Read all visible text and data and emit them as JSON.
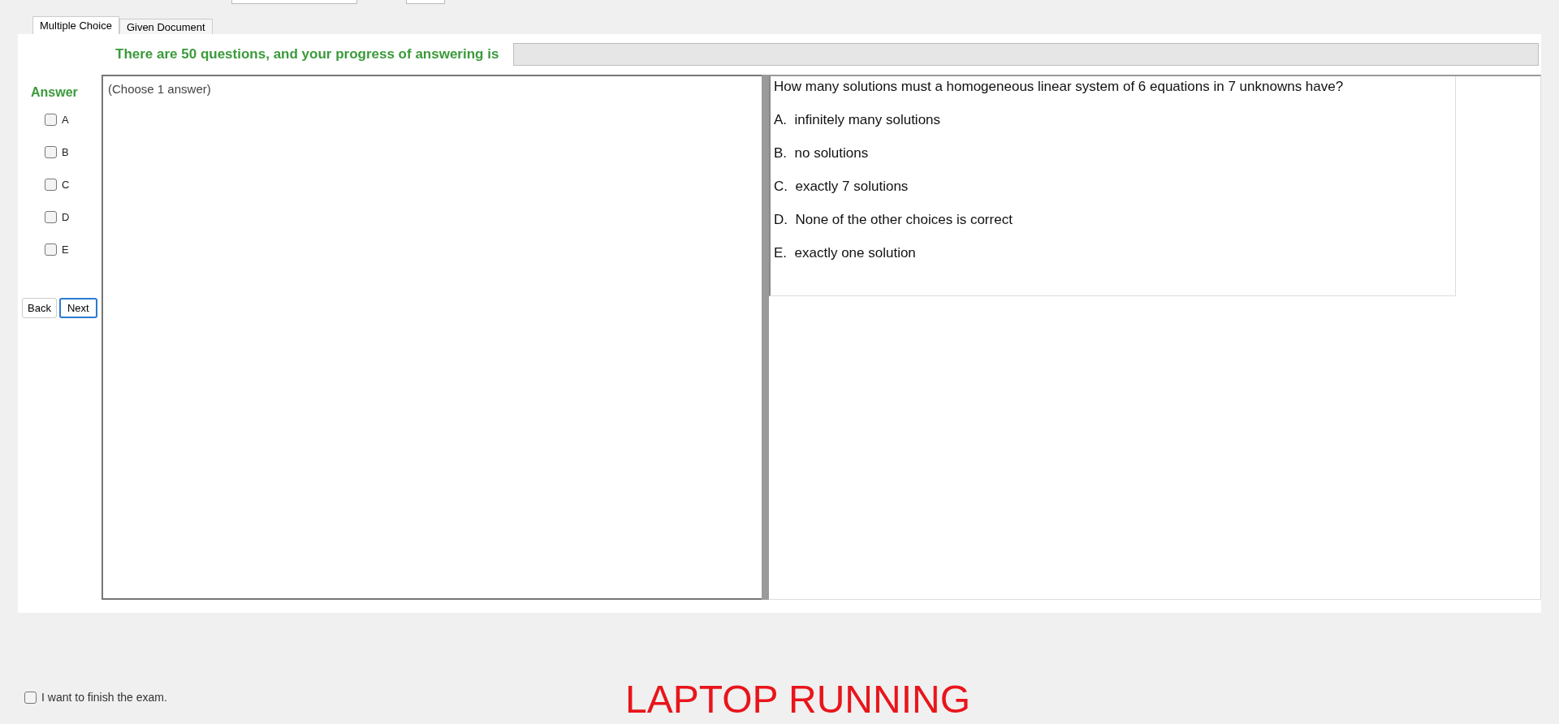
{
  "tabs": [
    {
      "label": "Multiple Choice",
      "selected": true
    },
    {
      "label": "Given Document",
      "selected": false
    }
  ],
  "progress": {
    "text": "There are 50 questions, and your progress of answering is",
    "level": 0
  },
  "answer": {
    "title": "Answer",
    "options": [
      {
        "label": "A",
        "checked": false
      },
      {
        "label": "B",
        "checked": false
      },
      {
        "label": "C",
        "checked": false
      },
      {
        "label": "D",
        "checked": false
      },
      {
        "label": "E",
        "checked": false
      }
    ]
  },
  "buttons": [
    {
      "label": "Back",
      "focused": false
    },
    {
      "label": "Next",
      "focused": true
    }
  ],
  "answer_box": {
    "hint": "(Choose 1 answer)"
  },
  "question": {
    "text": "How many solutions must a homogeneous linear system of 6 equations in 7 unknowns have?",
    "choices": [
      "A.  infinitely many solutions",
      "B.  no solutions",
      "C.  exactly 7 solutions",
      "D.  None of the other choices is correct",
      "E.  exactly one solution"
    ]
  },
  "finish": {
    "label": "I want to finish the exam.",
    "checked": false
  },
  "status": "LAPTOP RUNNING"
}
